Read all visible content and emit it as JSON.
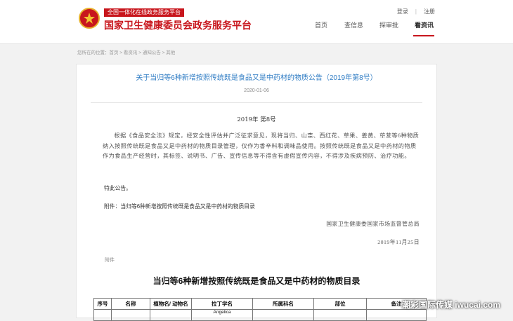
{
  "header": {
    "slogan": "全国一体化在线政务服务平台",
    "site_title": "国家卫生健康委员会政务服务平台",
    "login": "登录",
    "separator": "|",
    "register": "注册",
    "nav": [
      {
        "label": "首页"
      },
      {
        "label": "查信息"
      },
      {
        "label": "探审批"
      },
      {
        "label": "看资讯"
      }
    ],
    "accent_color": "#c8161d"
  },
  "breadcrumb": "您所在的位置：首页 > 看资讯 > 通知公告 > 其他",
  "article": {
    "title": "关于当归等6种新增按照传统既是食品又是中药材的物质公告（2019年第8号）",
    "date": "2020-01-06",
    "issue": "2019年 第8号",
    "paragraph": "根据《食品安全法》规定，经安全性评估并广泛征求意见，现将当归、山柰、西红花、草果、姜黄、荜茇等6种物质纳入按照传统既是食品又是中药材的物质目录管理，仅作为香辛料和调味品使用。按照传统既是食品又是中药材的物质作为食品生产经营时，其标签、说明书、广告、宣传信息等不得含有虚假宣传内容，不得涉及疾病预防、治疗功能。",
    "special_notice": "特此公告。",
    "attachment_line": "附件：当归等6种新增按照传统既是食品又是中药材的物质目录",
    "signatory": "国家卫生健康委国家市场监督管总局",
    "signed_date": "2019年11月25日",
    "attachment_heading": "附件",
    "table_title": "当归等6种新增按照传统既是食品又是中药材的物质目录",
    "table_headers": [
      "序号",
      "名称",
      "植物名/ 动物名",
      "拉丁学名",
      "所属科名",
      "部位",
      "备注"
    ],
    "first_row_latin_fragment": "Angelica"
  },
  "watermark": "潮彩国际传媒 iwucai.com"
}
